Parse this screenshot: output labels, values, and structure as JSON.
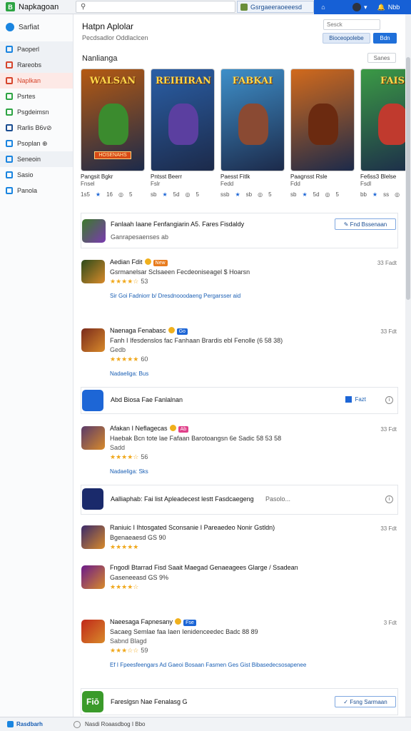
{
  "app": {
    "title": "Napkagoan"
  },
  "search": {
    "placeholder": "",
    "chip": "Gsrgaeeraoeeesd"
  },
  "topbar": {
    "home": "⌂",
    "chev": "▾",
    "notif": "🔔",
    "extra": "Nbb"
  },
  "sidebar": {
    "header": "Sarfiat",
    "items": [
      {
        "label": "Paoperl",
        "color": "#1a85e0",
        "group": true
      },
      {
        "label": "Rareobs",
        "color": "#d6452c",
        "group": true
      },
      {
        "label": "Naplkan",
        "color": "#d6452c",
        "active": true
      },
      {
        "label": "Psrtes",
        "color": "#2da443"
      },
      {
        "label": "Psgdeimsn",
        "color": "#2da443"
      },
      {
        "label": "Rarlis B6v⊘",
        "color": "#1a4d91"
      },
      {
        "label": "Psoplan ⊕",
        "color": "#1a85e0"
      },
      {
        "label": "Seneoin",
        "color": "#1a85e0",
        "group": true
      },
      {
        "label": "Sasio",
        "color": "#1a85e0"
      },
      {
        "label": "Panola",
        "color": "#1a85e0"
      }
    ]
  },
  "header": {
    "title": "Hatpn Aplolar",
    "subtitle": "Pecdsadlor Oddlaclcen",
    "input": "Sesck",
    "button1": "Bioceopolebe",
    "button2": "Bdn"
  },
  "featured": {
    "label": "Nanlianga",
    "more": "Sanes",
    "cards": [
      {
        "banner": "WALSAN",
        "ribbon": "HOSENAHS",
        "name": "Pangsit Bgkr",
        "sub": "Fnsel",
        "count": "1s5",
        "score": "16",
        "bg": "#b55a12",
        "hero": "#3b8b2e",
        "extra": "5"
      },
      {
        "banner": "REIHIRAN",
        "ribbon": "",
        "name": "Pntsst Beerr",
        "sub": "Fslr",
        "count": "sb",
        "score": "5d",
        "bg": "#2a5fa6",
        "hero": "#5b3fa0",
        "extra": "5"
      },
      {
        "banner": "FABKAI",
        "ribbon": "",
        "name": "Paesst Fitlk",
        "sub": "Fedd",
        "count": "ssb",
        "score": "sb",
        "bg": "#3e8fc9",
        "hero": "#8a4a33",
        "extra": "5"
      },
      {
        "banner": "",
        "ribbon": "",
        "name": "Paagnsst Rsle",
        "sub": "Fdd",
        "count": "sb",
        "score": "5d",
        "bg": "#d26a1c",
        "hero": "#6b2a10",
        "extra": "5"
      },
      {
        "banner": "FAIS",
        "ribbon": "",
        "name": "Fe6ss3 Blelse",
        "sub": "Fsdl",
        "count": "bb",
        "score": "ss",
        "bg": "#3b9a45",
        "hero": "#c03a2e",
        "extra": ""
      }
    ]
  },
  "list": {
    "sponsor": {
      "title": "Fanlaah Iaane Fenfangiarin A5. Fares Fisdaldy",
      "line": "Ganrapesaenses ab",
      "button": "✎  Fnd Bssenaan"
    },
    "apps": [
      {
        "title": "Aedian Fdit",
        "tag": "New",
        "tag_color": "#e87c1e",
        "line": "Gsrmanelsar Sclsaeen Fecdeoniseagel $ Hoarsn",
        "stars": "★★★★☆",
        "rating": "53",
        "link": "Sir  Goi Fadniorr b/ Dresdnooodaeng  Pergarsser  aid",
        "date": "33 Fadt",
        "icon_bg": "#2c4a1a"
      },
      {
        "title": "Naenaga Fenabasc",
        "tag": "Go",
        "tag_color": "#1d66d6",
        "line": "Fanh I Ifesdenslos fac Fanhaan Brardis ebl Fenolle (6 58 38)",
        "line2": "Gedb",
        "stars": "★★★★★",
        "rating": "60",
        "link": "Nadaeliga: Bus",
        "date": "33 Fdt",
        "icon_bg": "#7a2a1c"
      }
    ],
    "banner": {
      "title": "Abd  Biosa  Fae Fanlalnan",
      "button": "Fazt",
      "icon_bg": "#1d66d6"
    },
    "apps2": [
      {
        "title": "Afakan I Neflagecas",
        "tag": "Ab",
        "tag_color": "#e0408a",
        "line": "Haebak Bcn tote lae Fafaan Barotoangsn 6e Sadic 58 53 58",
        "line2": "Sadd",
        "stars": "★★★★☆",
        "rating": "56",
        "link": "Nadaeliga: Sks",
        "date": "33 Fdt",
        "icon_bg": "#5a3a6a"
      }
    ],
    "promo": {
      "title": "Aalliaphab: Fai  list Apleadecest lestt Fasdcaegeng",
      "more": "Pasolo...",
      "icon_bg": "#1a2a6b"
    },
    "apps3": [
      {
        "title": "Raniuic I Ihtosgated Sconsanie I Pareaedeo  Nonir Gstldn)",
        "stars": "★★★★★",
        "line": "Bgenaeaesd GS 90",
        "date": "33 Fdt",
        "icon_bg": "#3a2a6b"
      },
      {
        "title": "Fngodl Btarrad Fisd Saait Maegad Genaeagees Glarge / Ssadean",
        "stars": "★★★★☆",
        "line": "Gaseneeasd GS 9%",
        "date": "",
        "icon_bg": "#6a1a8a"
      },
      {
        "title": "Naeesaga Fapnesany",
        "tag": "Fse",
        "tag_color": "#1d66d6",
        "line": "Sacaeg Semlae faa Iaen Ienidenceedec Badc 88 89",
        "line2": "Sabnd Blagd",
        "stars": "★★★☆☆",
        "rating": "59",
        "link": "Ef  I Fpeesfeengars Ad  Gaeoi Bosaan Fasmen Ges Gist Bibasedecsosapenee",
        "date": "3 Fdt",
        "icon_bg": "#c0281a"
      }
    ],
    "bottom": {
      "title": "Fareslgsn Nae  Fenalasg  G",
      "button": "✓  Fsng Sarmaan",
      "icon_bg": "#3a9a2a",
      "icon_text": "Fiō"
    }
  },
  "status": {
    "left": "Rasdbarh",
    "mid": "Nasdi Roaasdbog  I Bbo"
  }
}
